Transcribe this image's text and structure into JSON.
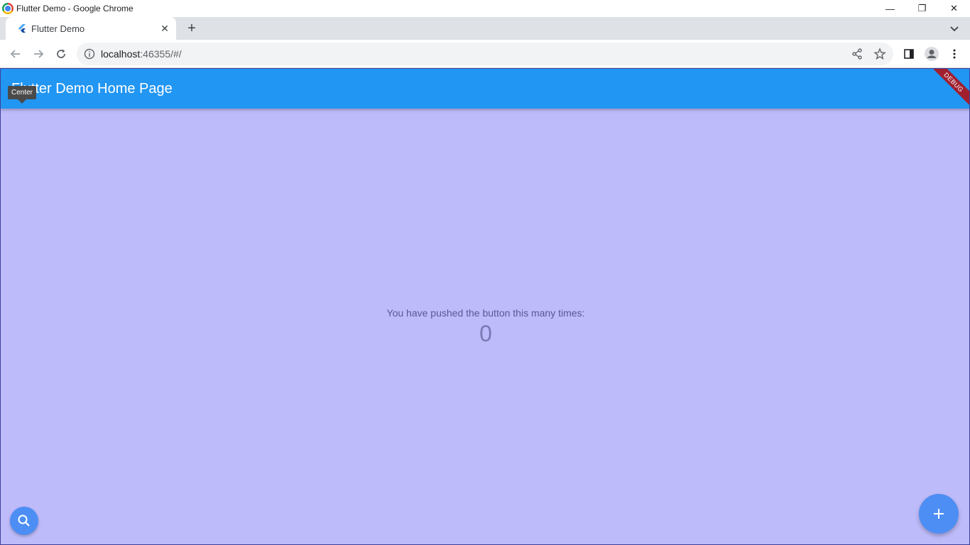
{
  "window": {
    "title": "Flutter Demo - Google Chrome",
    "minimize_glyph": "—",
    "restore_glyph": "❐",
    "close_glyph": "✕"
  },
  "tabs": [
    {
      "title": "Flutter Demo",
      "close_glyph": "✕"
    }
  ],
  "new_tab_glyph": "+",
  "toolbar": {
    "url_host": "localhost",
    "url_rest": ":46355/#/"
  },
  "app": {
    "appbar_title": "Flutter Demo Home Page",
    "debug_banner": "DEBUG",
    "tooltip": "Center",
    "counter_label": "You have pushed the button this many times:",
    "counter_value": "0",
    "fab_add_glyph": "+"
  },
  "colors": {
    "appbar": "#2196f3",
    "background": "#bebbfa",
    "fab": "#4d8ef4",
    "debug_banner": "#a0202f"
  },
  "icons": {
    "back": "back-arrow-icon",
    "forward": "forward-arrow-icon",
    "reload": "reload-icon",
    "info": "site-info-icon",
    "share": "share-icon",
    "bookmark": "star-icon",
    "side_panel": "side-panel-icon",
    "profile": "profile-icon",
    "menu": "kebab-menu-icon",
    "search": "search-icon",
    "add": "add-icon"
  }
}
